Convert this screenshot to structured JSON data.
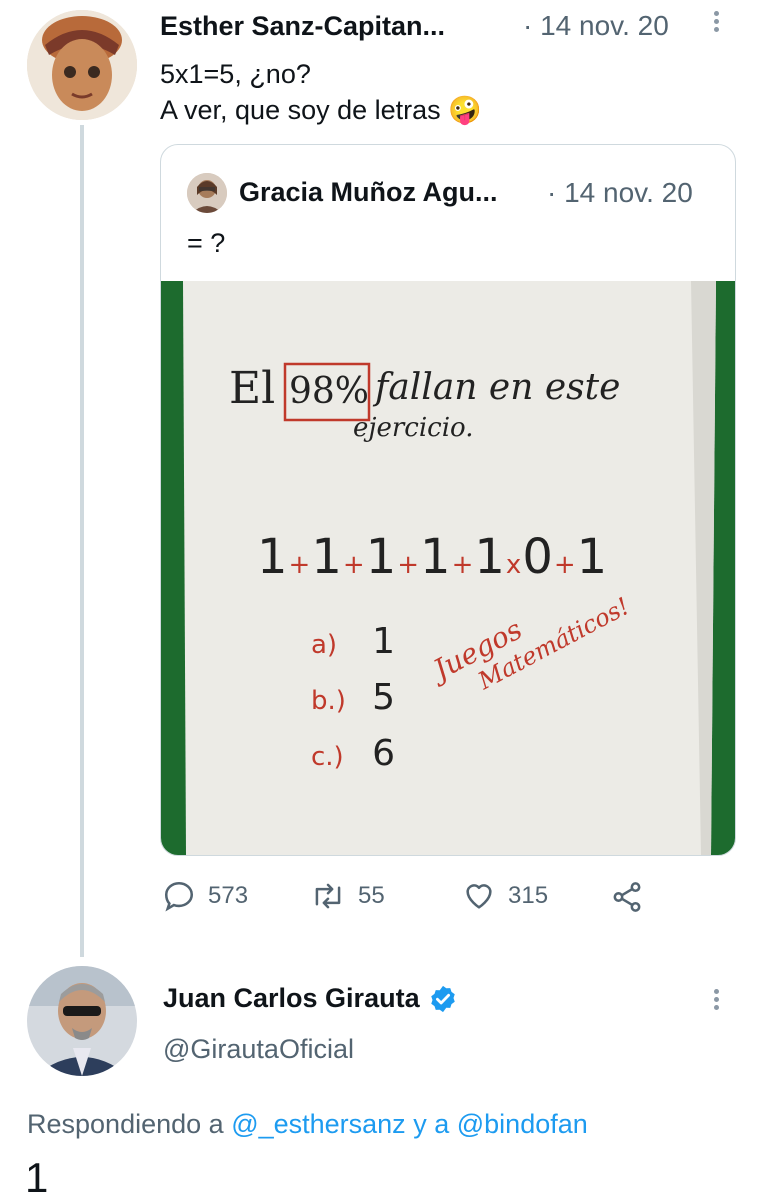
{
  "tweet": {
    "author_name": "Esther Sanz-Capitan...",
    "date": "· 14 nov. 20",
    "text_line1": "5x1=5, ¿no?",
    "text_line2": "A ver, que soy de letras",
    "emoji": "🤪"
  },
  "quoted": {
    "author_name": "Gracia Muñoz Agu...",
    "date": "· 14 nov. 20",
    "text": "= ?",
    "image": {
      "line1_a": "El",
      "line1_b": "98%",
      "line1_c": "fallan en este",
      "line2": "ejercicio.",
      "equation": [
        "1",
        "+",
        "1",
        "+",
        "1",
        "+",
        "1",
        "+",
        "1",
        "x",
        "0",
        "+",
        "1"
      ],
      "options": [
        {
          "label": "a)",
          "value": "1"
        },
        {
          "label": "b.)",
          "value": "5"
        },
        {
          "label": "c.)",
          "value": "6"
        }
      ],
      "note_line1": "Juegos",
      "note_line2": "Matemáticos!"
    }
  },
  "actions": {
    "replies": "573",
    "retweets": "55",
    "likes": "315"
  },
  "reply": {
    "author_name": "Juan Carlos Girauta",
    "handle": "@GirautaOficial",
    "replying_prefix": "Respondiendo a",
    "mention1": "@_esthersanz",
    "connector": "y a",
    "mention2": "@bindofan",
    "text": "1"
  },
  "colors": {
    "accent": "#1d9bf0",
    "text_grey": "#536471",
    "marker_red": "#c0392b",
    "paper": "#ecebe6",
    "board_green": "#1d6b2e"
  }
}
